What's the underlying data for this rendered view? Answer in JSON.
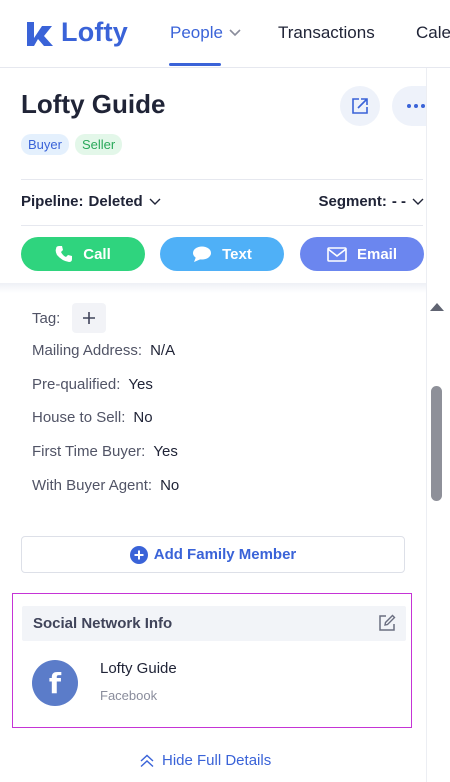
{
  "nav": {
    "logo_text": "Lofty",
    "items": [
      {
        "label": "People"
      },
      {
        "label": "Transactions"
      },
      {
        "label": "Cale"
      }
    ]
  },
  "profile": {
    "name": "Lofty Guide",
    "badges": [
      "Buyer",
      "Seller"
    ],
    "pipeline_label": "Pipeline:",
    "pipeline_value": "Deleted",
    "segment_label": "Segment:",
    "segment_value": "- -"
  },
  "actions": {
    "call": "Call",
    "text": "Text",
    "email": "Email"
  },
  "details": {
    "tag_label": "Tag:",
    "fields": [
      {
        "label": "Mailing Address:",
        "value": "N/A"
      },
      {
        "label": "Pre-qualified:",
        "value": "Yes"
      },
      {
        "label": "House to Sell:",
        "value": "No"
      },
      {
        "label": "First Time Buyer:",
        "value": "Yes"
      },
      {
        "label": "With Buyer Agent:",
        "value": "No"
      }
    ],
    "add_family": "Add Family Member"
  },
  "social": {
    "title": "Social Network Info",
    "account_name": "Lofty Guide",
    "network": "Facebook",
    "avatar_glyph": "f"
  },
  "footer": {
    "hide_details": "Hide Full Details"
  },
  "colors": {
    "brand": "#3a63d8",
    "call": "#2fd47e",
    "text": "#4fb0f7",
    "email": "#6b86ef"
  }
}
